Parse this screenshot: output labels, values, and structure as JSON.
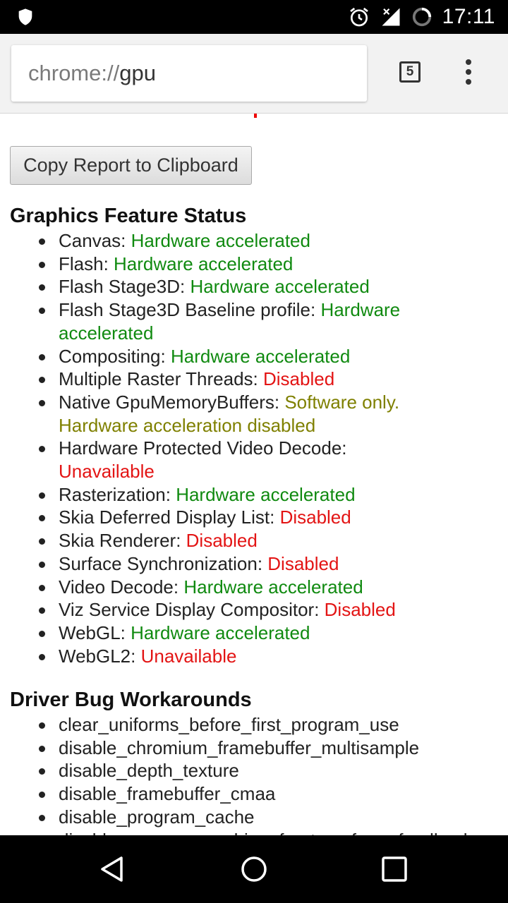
{
  "status_bar": {
    "time": "17:11",
    "icons": [
      "shield-icon",
      "alarm-icon",
      "signal-icon",
      "sync-icon"
    ]
  },
  "toolbar": {
    "url_scheme": "chrome://",
    "url_host": "gpu",
    "tab_count": "5",
    "menu_icon": "more-vert-icon"
  },
  "copy_button": {
    "label": "Copy Report to Clipboard"
  },
  "graphics_feature_status": {
    "heading": "Graphics Feature Status",
    "items": [
      {
        "name": "Canvas: ",
        "status": "Hardware accelerated",
        "color": "#108a10"
      },
      {
        "name": "Flash: ",
        "status": "Hardware accelerated",
        "color": "#108a10"
      },
      {
        "name": "Flash Stage3D: ",
        "status": "Hardware accelerated",
        "color": "#108a10"
      },
      {
        "name": "Flash Stage3D Baseline profile: ",
        "status": "Hardware accelerated",
        "color": "#108a10"
      },
      {
        "name": "Compositing: ",
        "status": "Hardware accelerated",
        "color": "#108a10"
      },
      {
        "name": "Multiple Raster Threads: ",
        "status": "Disabled",
        "color": "#e31414"
      },
      {
        "name": "Native GpuMemoryBuffers: ",
        "status": "Software only. Hardware acceleration disabled",
        "color": "#7f8000"
      },
      {
        "name": "Hardware Protected Video Decode: ",
        "status": "Unavailable",
        "color": "#e31414"
      },
      {
        "name": "Rasterization: ",
        "status": "Hardware accelerated",
        "color": "#108a10"
      },
      {
        "name": "Skia Deferred Display List: ",
        "status": "Disabled",
        "color": "#e31414"
      },
      {
        "name": "Skia Renderer: ",
        "status": "Disabled",
        "color": "#e31414"
      },
      {
        "name": "Surface Synchronization: ",
        "status": "Disabled",
        "color": "#e31414"
      },
      {
        "name": "Video Decode: ",
        "status": "Hardware accelerated",
        "color": "#108a10"
      },
      {
        "name": "Viz Service Display Compositor: ",
        "status": "Disabled",
        "color": "#e31414"
      },
      {
        "name": "WebGL: ",
        "status": "Hardware accelerated",
        "color": "#108a10"
      },
      {
        "name": "WebGL2: ",
        "status": "Unavailable",
        "color": "#e31414"
      }
    ]
  },
  "driver_bug_workarounds": {
    "heading": "Driver Bug Workarounds",
    "items": [
      "clear_uniforms_before_first_program_use",
      "disable_chromium_framebuffer_multisample",
      "disable_depth_texture",
      "disable_framebuffer_cmaa",
      "disable_program_cache",
      "disable_program_caching_for_transform_feedback"
    ]
  },
  "nav_bar": {
    "icons": [
      "back-icon",
      "home-icon",
      "recents-icon"
    ]
  }
}
